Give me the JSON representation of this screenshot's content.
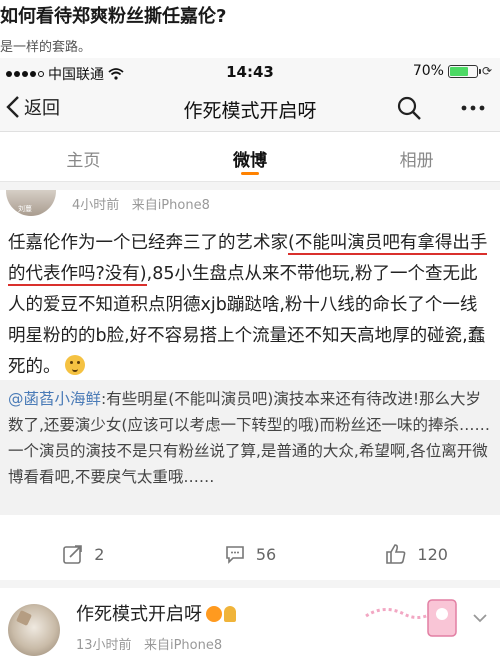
{
  "article": {
    "title": "如何看待郑爽粉丝撕任嘉伦?",
    "subtitle": "是一样的套路。"
  },
  "status_bar": {
    "carrier": "中国联通",
    "time": "14:43",
    "battery": "70%",
    "battery_level": 0.7
  },
  "nav": {
    "back_label": "返回",
    "title": "作死模式开启呀"
  },
  "tabs": [
    {
      "label": "主页"
    },
    {
      "label": "微博",
      "active": true
    },
    {
      "label": "相册"
    }
  ],
  "post": {
    "avatar_label": "刘蔓",
    "time": "4小时前",
    "source": "来自iPhone8",
    "text_part1": "任嘉伦作为一个已经奔三了的艺术家",
    "text_highlight": "(不能叫演员吧有拿得出手的代表作吗?没有)",
    "text_part2": ",85小生盘点从来不带他玩,粉了一个查无此人的爱豆不知道积点阴德xjb蹦跶啥,粉十八线的命长了个一线明星粉的的b脸,好不容易搭上个流量还不知天高地厚的碰瓷,蠢死的。",
    "repost_user": "@菡萏小海鲜",
    "repost_text": ":有些明星(不能叫演员吧)演技本来还有待改进!那么大岁数了,还要演少女(应该可以考虑一下转型的哦)而粉丝还一味的捧杀……一个演员的演技不是只有粉丝说了算,是普通的大众,希望啊,各位离开微博看看吧,不要戾气太重哦……",
    "reposts": "2",
    "comments": "56",
    "likes": "120"
  },
  "next_post": {
    "name": "作死模式开启呀",
    "time": "13小时前",
    "source": "来自iPhone8"
  },
  "colors": {
    "accent": "#ff8200",
    "link": "#4a7bb7",
    "underline": "#d9302c"
  },
  "icons": [
    "wifi-icon",
    "battery-icon",
    "back-chevron-icon",
    "search-icon",
    "more-icon",
    "repost-icon",
    "comment-icon",
    "like-icon",
    "chevron-down-icon"
  ]
}
